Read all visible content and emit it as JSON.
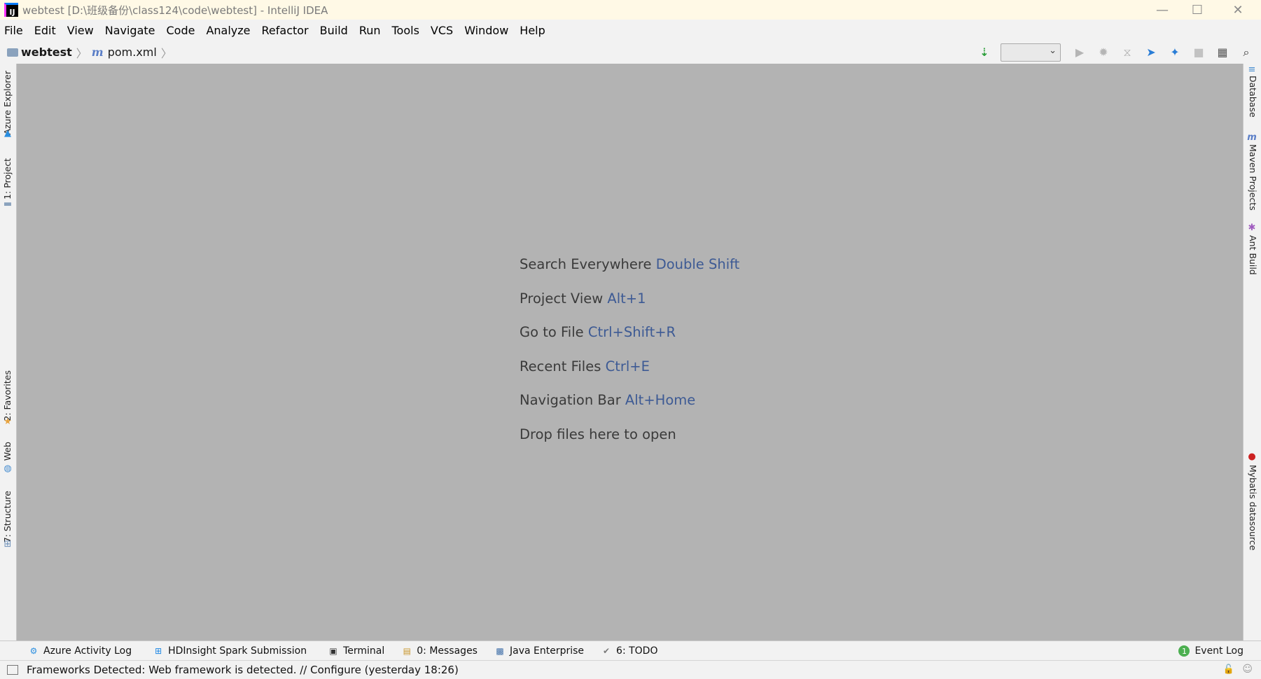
{
  "window": {
    "title": "webtest [D:\\班级备份\\class124\\code\\webtest] - IntelliJ IDEA",
    "app_icon_text": "IJ",
    "controls": {
      "minimize": "—",
      "maximize": "☐",
      "close": "✕"
    }
  },
  "menu": {
    "items": [
      "File",
      "Edit",
      "View",
      "Navigate",
      "Code",
      "Analyze",
      "Refactor",
      "Build",
      "Run",
      "Tools",
      "VCS",
      "Window",
      "Help"
    ]
  },
  "navbar": {
    "project": "webtest",
    "file_icon": "m",
    "file": "pom.xml",
    "run_config": ""
  },
  "left_strip": {
    "tabs": [
      "Azure Explorer",
      "1: Project",
      "2: Favorites",
      "Web",
      "7: Structure"
    ]
  },
  "right_strip": {
    "tabs": [
      "Database",
      "Maven Projects",
      "Ant Build",
      "Mybatis datasource"
    ]
  },
  "editor": {
    "hints": [
      {
        "text": "Search Everywhere",
        "key": "Double Shift"
      },
      {
        "text": "Project View",
        "key": "Alt+1"
      },
      {
        "text": "Go to File",
        "key": "Ctrl+Shift+R"
      },
      {
        "text": "Recent Files",
        "key": "Ctrl+E"
      },
      {
        "text": "Navigation Bar",
        "key": "Alt+Home"
      },
      {
        "text": "Drop files here to open",
        "key": ""
      }
    ]
  },
  "bottom_tools": {
    "items": [
      "Azure Activity Log",
      "HDInsight Spark Submission",
      "Terminal",
      "0: Messages",
      "Java Enterprise",
      "6: TODO"
    ],
    "event_log": "Event Log",
    "event_log_count": "1"
  },
  "status": {
    "message": "Frameworks Detected: Web framework is detected. // Configure (yesterday 18:26)"
  },
  "colors": {
    "editor_bg": "#b3b3b3",
    "shortcut_key": "#3d5a94",
    "title_bg": "#fff9e6"
  }
}
